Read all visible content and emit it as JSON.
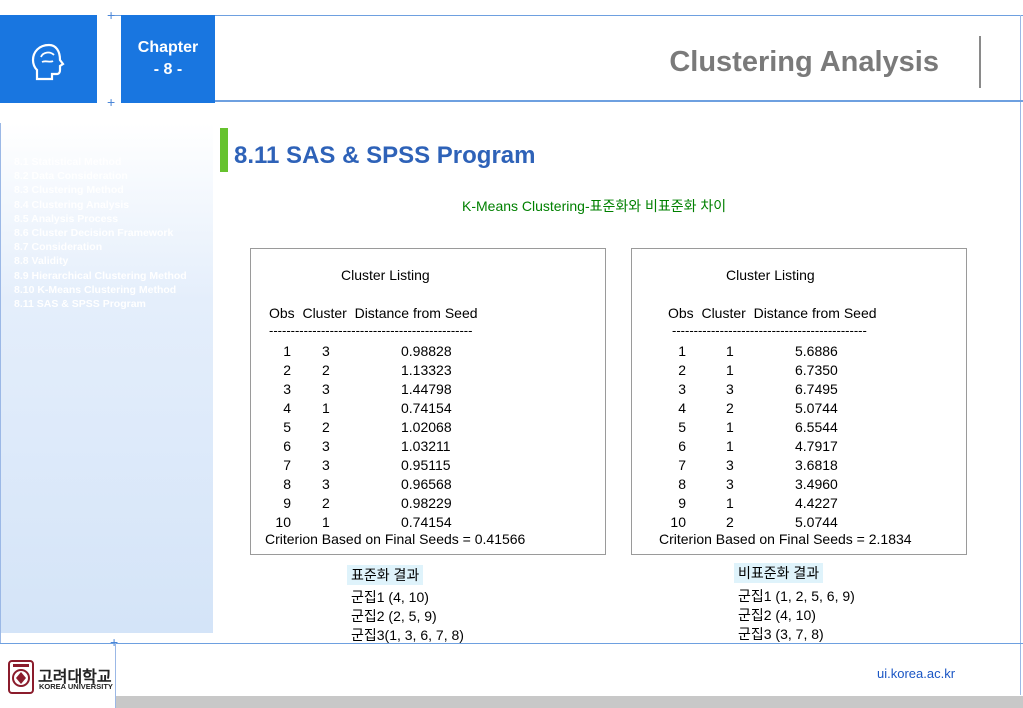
{
  "header": {
    "chapter_line1": "Chapter",
    "chapter_line2": "- 8 -",
    "title": "Clustering Analysis"
  },
  "sidebar": {
    "items": [
      "8.1 Statistical Method",
      "8.2 Data Consideration",
      "8.3 Clustering Method",
      "8.4 Clustering Analysis",
      "8.5 Analysis Process",
      "8.6 Cluster Decision Framework",
      "8.7 Consideration",
      "8.8 Validity",
      "8.9 Hierarchical Clustering Method",
      "8.10 K-Means Clustering Method",
      "8.11 SAS & SPSS Program"
    ],
    "active_index": 10
  },
  "section": {
    "title": "8.11 SAS & SPSS Program",
    "subtitle": "K-Means Clustering-표준화와 비표준화 차이"
  },
  "listing_standardized": {
    "title": "Cluster Listing",
    "header": "Obs  Cluster  Distance from Seed",
    "dashes": "-----------------------------------------------",
    "rows": [
      {
        "obs": "1",
        "cluster": "3",
        "distance": "0.98828"
      },
      {
        "obs": "2",
        "cluster": "2",
        "distance": "1.13323"
      },
      {
        "obs": "3",
        "cluster": "3",
        "distance": "1.44798"
      },
      {
        "obs": "4",
        "cluster": "1",
        "distance": "0.74154"
      },
      {
        "obs": "5",
        "cluster": "2",
        "distance": "1.02068"
      },
      {
        "obs": "6",
        "cluster": "3",
        "distance": "1.03211"
      },
      {
        "obs": "7",
        "cluster": "3",
        "distance": "0.95115"
      },
      {
        "obs": "8",
        "cluster": "3",
        "distance": "0.96568"
      },
      {
        "obs": "9",
        "cluster": "2",
        "distance": "0.98229"
      },
      {
        "obs": "10",
        "cluster": "1",
        "distance": "0.74154"
      }
    ],
    "criterion": "Criterion Based on Final Seeds = 0.41566"
  },
  "listing_raw": {
    "title": "Cluster Listing",
    "header": "Obs  Cluster  Distance from Seed",
    "dashes": "---------------------------------------------",
    "rows": [
      {
        "obs": "1",
        "cluster": "1",
        "distance": "5.6886"
      },
      {
        "obs": "2",
        "cluster": "1",
        "distance": "6.7350"
      },
      {
        "obs": "3",
        "cluster": "3",
        "distance": "6.7495"
      },
      {
        "obs": "4",
        "cluster": "2",
        "distance": "5.0744"
      },
      {
        "obs": "5",
        "cluster": "1",
        "distance": "6.5544"
      },
      {
        "obs": "6",
        "cluster": "1",
        "distance": "4.7917"
      },
      {
        "obs": "7",
        "cluster": "3",
        "distance": "3.6818"
      },
      {
        "obs": "8",
        "cluster": "3",
        "distance": "3.4960"
      },
      {
        "obs": "9",
        "cluster": "1",
        "distance": "4.4227"
      },
      {
        "obs": "10",
        "cluster": "2",
        "distance": "5.0744"
      }
    ],
    "criterion": "Criterion Based on Final Seeds = 2.1834"
  },
  "results_standardized": {
    "title": "표준화 결과",
    "lines": [
      "군집1 (4, 10)",
      "군집2 (2, 5, 9)",
      "군집3(1, 3, 6, 7, 8)"
    ]
  },
  "results_raw": {
    "title": "비표준화 결과",
    "lines": [
      "군집1 (1, 2, 5, 6, 9)",
      "군집2 (4, 10)",
      "군집3 (3, 7, 8)"
    ]
  },
  "footer": {
    "url": "ui.korea.ac.kr",
    "logo_korean": "고려대학교",
    "logo_english": "KOREA UNIVERSITY"
  },
  "colors": {
    "brand_blue": "#1976e0",
    "title_gray": "#7a7a7a",
    "section_blue": "#2e62b8",
    "accent_green": "#66c22e",
    "subtitle_green": "#008000"
  }
}
